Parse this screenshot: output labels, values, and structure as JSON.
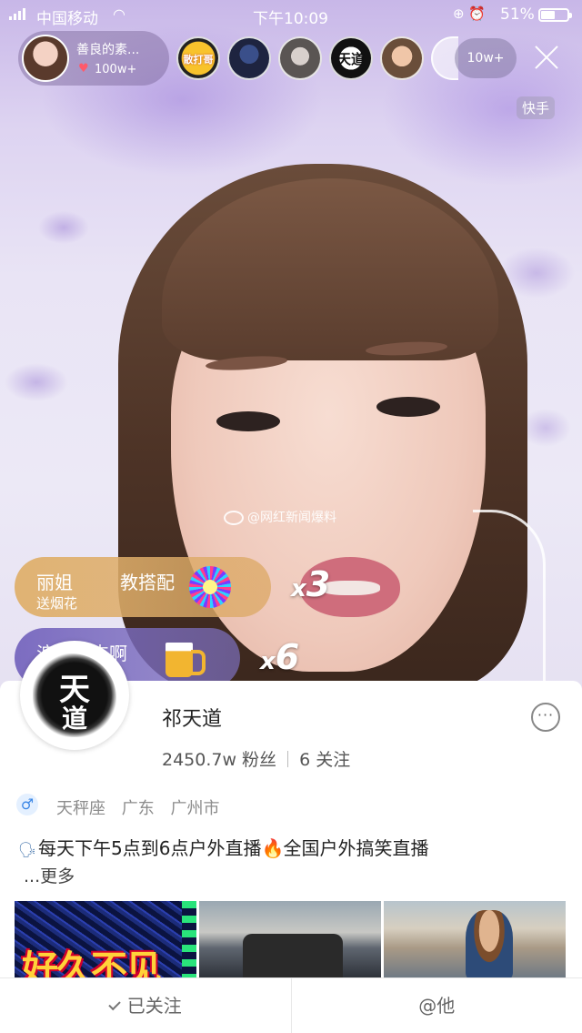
{
  "status_bar": {
    "carrier": "中国移动",
    "time": "下午10:09",
    "battery": "51%"
  },
  "live": {
    "host_name": "善良的素...",
    "host_likes": "100w+",
    "viewer_badge_1": "散打哥",
    "viewer_badge_2": "天道",
    "viewer_count": "10w+",
    "brand": "快手",
    "watermark": "@网红新闻爆料"
  },
  "gifts": [
    {
      "sender": "丽姐",
      "target": "教搭配",
      "gift_name": "送烟花",
      "combo_prefix": "x",
      "combo": "3"
    },
    {
      "sender": "浪子呀杰啊",
      "combo_prefix": "x",
      "combo": "6"
    }
  ],
  "profile": {
    "avatar_glyph_1": "天",
    "avatar_glyph_2": "道",
    "username": "祁天道",
    "followers": "2450.7w 粉丝",
    "following": "6 关注",
    "constellation": "天秤座",
    "province": "广东",
    "city": "广州市",
    "bio_part1": "每天下午5点到6点户外直播",
    "bio_part2": "全国户外搞笑直播",
    "more": "...更多",
    "thumb1_caption": "好久不见"
  },
  "actions": {
    "followed": "已关注",
    "mention": "@他"
  },
  "icons": {
    "signal": "signal-icon",
    "wifi": "wifi-icon",
    "alarm": "alarm-icon",
    "battery": "battery-icon",
    "heart": "heart-icon",
    "close": "close-icon",
    "more": "more-icon",
    "gender": "male-icon",
    "fire": "fire-icon",
    "check": "check-icon"
  },
  "colors": {
    "gift1_bg": "#dfb06c",
    "gift2_bg": "#7666be",
    "gender_blue": "#3d88e6",
    "heart_red": "#ff5a6a"
  }
}
